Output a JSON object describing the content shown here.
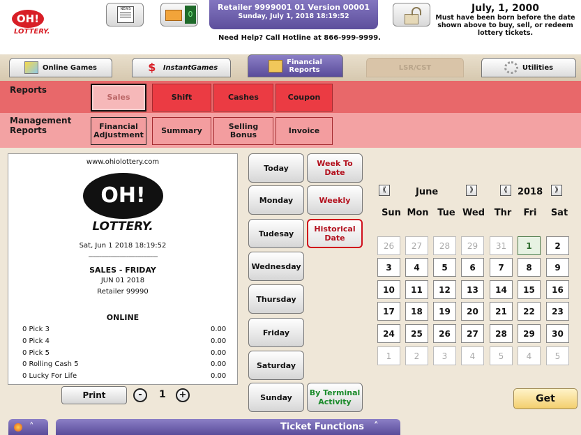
{
  "header": {
    "logo_mark": "OH!",
    "logo_text": "LOTTERY.",
    "info_line1": "Retailer 9999001  01  Version 00001",
    "info_line2": "Sunday, July 1, 2018 18:19:52",
    "hotline": "Need Help? Call Hotline at 866-999-9999.",
    "message_count": "0",
    "news_label": "NEWS",
    "dob_date": "July, 1, 2000",
    "dob_text": "Must have been born before the date shown above to buy, sell, or redeem lottery tickets."
  },
  "tabs": {
    "online_games": "Online Games",
    "instant_games_brand": "Instant",
    "instant_games_suffix": "Games",
    "financial_line1": "Financial",
    "financial_line2": "Reports",
    "lsr": "LSR/CST",
    "utilities": "Utilities"
  },
  "reports": {
    "label": "Reports",
    "buttons": [
      "Sales",
      "Shift",
      "Cashes",
      "Coupon"
    ]
  },
  "management": {
    "label_line1": "Management",
    "label_line2": "Reports",
    "buttons": [
      {
        "l1": "Financial",
        "l2": "Adjustment"
      },
      {
        "l1": "Summary",
        "l2": ""
      },
      {
        "l1": "Selling",
        "l2": "Bonus"
      },
      {
        "l1": "Invoice",
        "l2": ""
      }
    ]
  },
  "receipt": {
    "url": "www.ohiolottery.com",
    "logo_mark": "OH!",
    "logo_text": "LOTTERY.",
    "timestamp": "Sat, Jun 1 2018 18:19:52",
    "divider": "--------------------------------------",
    "title": "SALES - FRIDAY",
    "date": "JUN 01 2018",
    "retailer": "Retailer 99990",
    "section": "ONLINE",
    "rows": [
      {
        "name": "0 Pick 3",
        "value": "0.00"
      },
      {
        "name": "0 Pick 4",
        "value": "0.00"
      },
      {
        "name": "0 Pick 5",
        "value": "0.00"
      },
      {
        "name": "0 Rolling Cash 5",
        "value": "0.00"
      },
      {
        "name": "0 Lucky For Life",
        "value": "0.00"
      }
    ]
  },
  "print": {
    "label": "Print",
    "minus": "-",
    "copies": "1",
    "plus": "+"
  },
  "days": [
    "Today",
    "Monday",
    "Tudesay",
    "Wednesday",
    "Thursday",
    "Friday",
    "Saturday",
    "Sunday"
  ],
  "periods": {
    "week_l1": "Week To",
    "week_l2": "Date",
    "weekly": "Weekly",
    "hist_l1": "Historical",
    "hist_l2": "Date",
    "term_l1": "By Terminal",
    "term_l2": "Activity"
  },
  "calendar": {
    "prev": "⟪",
    "next": "⟫",
    "month": "June",
    "year": "2018",
    "weekdays": [
      "Sun",
      "Mon",
      "Tue",
      "Wed",
      "Thr",
      "Fri",
      "Sat"
    ],
    "weeks": [
      [
        "26",
        "27",
        "28",
        "29",
        "31",
        "1",
        "2"
      ],
      [
        "3",
        "4",
        "5",
        "6",
        "7",
        "8",
        "9"
      ],
      [
        "10",
        "11",
        "12",
        "13",
        "14",
        "15",
        "16"
      ],
      [
        "17",
        "18",
        "19",
        "20",
        "21",
        "22",
        "23"
      ],
      [
        "24",
        "25",
        "26",
        "27",
        "28",
        "29",
        "30"
      ],
      [
        "1",
        "2",
        "3",
        "4",
        "5",
        "4",
        "5"
      ]
    ],
    "selected_day": "1",
    "get_label": "Get"
  },
  "footer": {
    "ticket_functions": "Ticket Functions",
    "chevron": "˄"
  },
  "colors": {
    "reports_band": "#e8686a",
    "management_band": "#f3a2a3",
    "purple": "#5a4c9a",
    "brand_red": "#d81e26"
  }
}
